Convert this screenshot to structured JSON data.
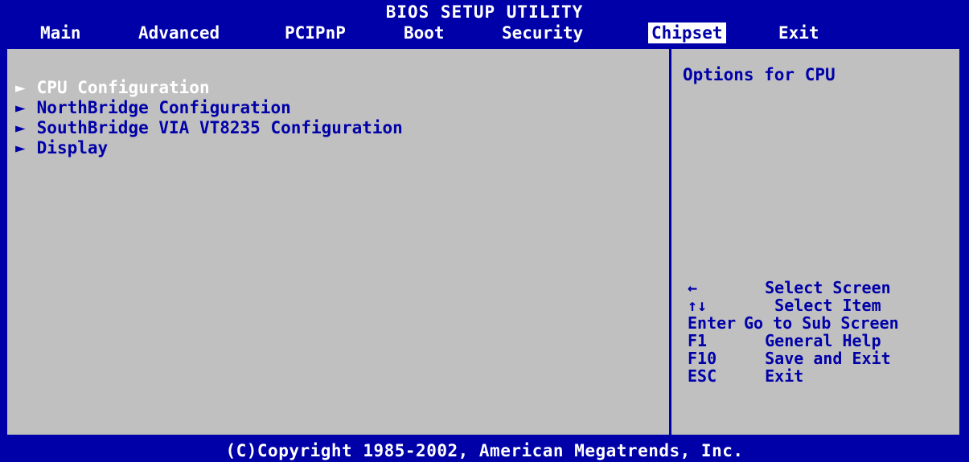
{
  "header": {
    "title": "BIOS SETUP UTILITY",
    "tabs": [
      {
        "label": "Main"
      },
      {
        "label": "Advanced"
      },
      {
        "label": "PCIPnP"
      },
      {
        "label": "Boot"
      },
      {
        "label": "Security"
      },
      {
        "label": "Chipset",
        "active": true
      },
      {
        "label": "Exit"
      }
    ]
  },
  "menu": {
    "arrow": "►",
    "items": [
      {
        "label": "CPU Configuration",
        "selected": true
      },
      {
        "label": "NorthBridge Configuration"
      },
      {
        "label": "SouthBridge VIA VT8235 Configuration"
      },
      {
        "label": "Display"
      }
    ]
  },
  "help": {
    "title": "Options for CPU",
    "keys": [
      {
        "key": "←",
        "action": "   Select Screen"
      },
      {
        "key": "↑↓",
        "action": "    Select Item"
      },
      {
        "key": "Enter",
        "action": "Go to Sub Screen"
      },
      {
        "key": "F1",
        "action": "   General Help"
      },
      {
        "key": "F10",
        "action": "   Save and Exit"
      },
      {
        "key": "ESC",
        "action": "   Exit"
      }
    ]
  },
  "footer": {
    "copyright": "(C)Copyright 1985-2002, American Megatrends, Inc."
  },
  "colors": {
    "background": "#0000a8",
    "panel": "#c0c0c0",
    "highlight_text": "#ffffff"
  }
}
